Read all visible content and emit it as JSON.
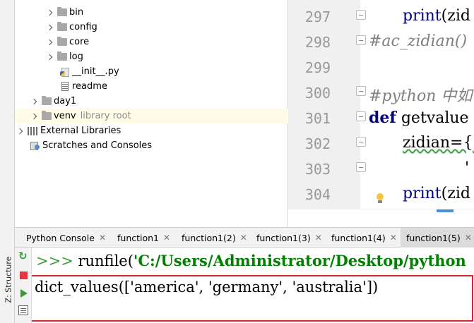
{
  "project_tree": {
    "items": [
      {
        "label": "bin",
        "type": "folder"
      },
      {
        "label": "config",
        "type": "folder"
      },
      {
        "label": "core",
        "type": "folder"
      },
      {
        "label": "log",
        "type": "folder"
      },
      {
        "label": "__init__.py",
        "type": "python-file"
      },
      {
        "label": "readme",
        "type": "text-file"
      },
      {
        "label": "day1",
        "type": "folder"
      },
      {
        "label": "venv",
        "type": "folder",
        "annotation": "library root"
      },
      {
        "label": "External Libraries",
        "type": "library"
      },
      {
        "label": "Scratches and Consoles",
        "type": "scratches"
      }
    ]
  },
  "editor": {
    "line_numbers": [
      "297",
      "298",
      "299",
      "300",
      "301",
      "302",
      "303",
      "304"
    ],
    "lines": {
      "l297": {
        "keyword": "print",
        "rest": "(zid"
      },
      "l298": {
        "comment": "#ac_zidian()"
      },
      "l300": {
        "comment": "#python 中如"
      },
      "l301": {
        "keyword": "def",
        "rest": " getvalue"
      },
      "l302": {
        "text": "zidian={'"
      },
      "l303": {
        "text": "'"
      },
      "l304": {
        "keyword": "print",
        "rest": "(zid"
      }
    }
  },
  "console_tabs": [
    {
      "label": "Python Console",
      "active": false
    },
    {
      "label": "function1",
      "active": false
    },
    {
      "label": "function1(2)",
      "active": false
    },
    {
      "label": "function1(3)",
      "active": false
    },
    {
      "label": "function1(4)",
      "active": false
    },
    {
      "label": "function1(5)",
      "active": true
    }
  ],
  "console": {
    "prompt": ">>>",
    "command_fn": " runfile(",
    "command_arg": "'C:/Users/Administrator/Desktop/python",
    "output": "dict_values(['america', 'germany', 'australia'])"
  },
  "side_panel": {
    "structure_label": "Z: Structure"
  },
  "colors": {
    "highlight_row": "#fefce6",
    "output_border": "#d6262c",
    "keyword": "#000080",
    "comment": "#808080",
    "prompt": "#3b9b3b"
  }
}
